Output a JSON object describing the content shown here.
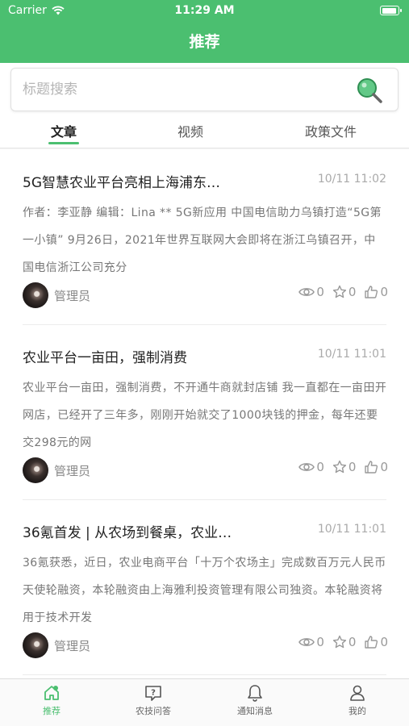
{
  "status_bar": {
    "carrier": "Carrier",
    "time": "11:29 AM"
  },
  "header": {
    "title": "推荐"
  },
  "search": {
    "placeholder": "标题搜索"
  },
  "tabs": [
    {
      "label": "文章"
    },
    {
      "label": "视频"
    },
    {
      "label": "政策文件"
    }
  ],
  "articles": [
    {
      "title": "5G智慧农业平台亮相上海浦东…",
      "date": "10/11 11:02",
      "summary": "作者：李亚静 编辑：Lina ** 5G新应用 中国电信助力乌镇打造“5G第一小镇” 9月26日，2021年世界互联网大会即将在浙江乌镇召开，中国电信浙江公司充分",
      "author": "管理员",
      "views": "0",
      "favorites": "0",
      "likes": "0"
    },
    {
      "title": "农业平台一亩田，强制消费",
      "date": "10/11 11:01",
      "summary": "农业平台一亩田，强制消费，不开通牛商就封店铺 我一直都在一亩田开网店，已经开了三年多，刚刚开始就交了1000块钱的押金，每年还要交298元的网",
      "author": "管理员",
      "views": "0",
      "favorites": "0",
      "likes": "0"
    },
    {
      "title": "36氪首发 | 从农场到餐桌，农业…",
      "date": "10/11 11:01",
      "summary": "36氪获悉，近日，农业电商平台「十万个农场主」完成数百万元人民币天使轮融资，本轮融资由上海雅利投资管理有限公司独资。本轮融资将用于技术开发",
      "author": "管理员",
      "views": "0",
      "favorites": "0",
      "likes": "0"
    }
  ],
  "bottom_nav": [
    {
      "label": "推荐",
      "icon": "home-icon"
    },
    {
      "label": "农技问答",
      "icon": "question-icon"
    },
    {
      "label": "通知消息",
      "icon": "bell-icon"
    },
    {
      "label": "我的",
      "icon": "user-icon"
    }
  ],
  "colors": {
    "accent": "#4bbf70"
  }
}
